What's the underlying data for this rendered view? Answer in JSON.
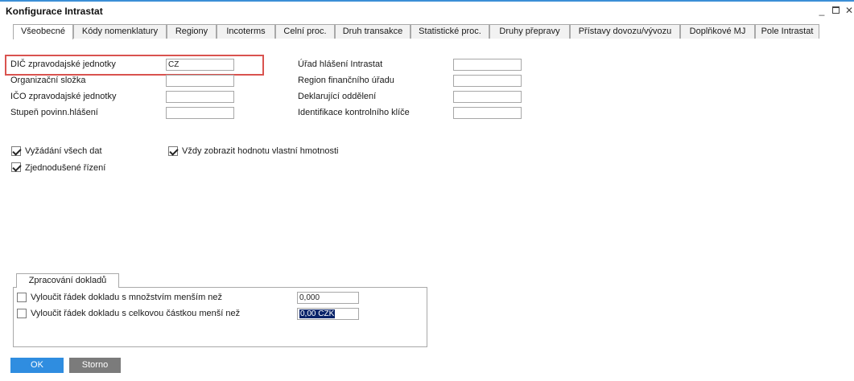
{
  "window": {
    "title": "Konfigurace Intrastat",
    "minimize_glyph": "_",
    "close_glyph": "✕"
  },
  "tabs": [
    {
      "label": "Všeobecné",
      "active": true
    },
    {
      "label": "Kódy nomenklatury",
      "active": false
    },
    {
      "label": "Regiony",
      "active": false
    },
    {
      "label": "Incoterms",
      "active": false
    },
    {
      "label": "Celní proc.",
      "active": false
    },
    {
      "label": "Druh transakce",
      "active": false
    },
    {
      "label": "Statistické proc.",
      "active": false
    },
    {
      "label": "Druhy přepravy",
      "active": false
    },
    {
      "label": "Přístavy dovozu/vývozu",
      "active": false
    },
    {
      "label": "Doplňkové MJ",
      "active": false
    },
    {
      "label": "Pole Intrastat",
      "active": false
    }
  ],
  "left_fields": [
    {
      "label": "DIČ zpravodajské jednotky",
      "value": "CZ"
    },
    {
      "label": "Organizační složka",
      "value": ""
    },
    {
      "label": "IČO zpravodajské jednotky",
      "value": ""
    },
    {
      "label": "Stupeň povinn.hlášení",
      "value": ""
    }
  ],
  "right_fields": [
    {
      "label": "Úřad hlášení Intrastat",
      "value": ""
    },
    {
      "label": "Region finančního úřadu",
      "value": ""
    },
    {
      "label": "Deklarující oddělení",
      "value": ""
    },
    {
      "label": "Identifikace kontrolního klíče",
      "value": ""
    }
  ],
  "checkboxes": [
    {
      "label": "Vyžádání všech dat",
      "checked": true
    },
    {
      "label": "Vždy zobrazit hodnotu vlastní hmotnosti",
      "checked": true
    },
    {
      "label": "Zjednodušené řízení",
      "checked": true
    }
  ],
  "document_processing": {
    "tab_label": "Zpracování dokladů",
    "rows": [
      {
        "label": "Vyloučit řádek dokladu s množstvím menším než",
        "checked": false,
        "value": "0,000"
      },
      {
        "label": "Vyloučit řádek dokladu s celkovou částkou menší než",
        "checked": false,
        "value": "0,00 CZK"
      }
    ]
  },
  "buttons": {
    "ok": "OK",
    "cancel": "Storno"
  },
  "colors": {
    "accent": "#2f8de0",
    "cancel_button": "#7b7b7b",
    "highlight_frame": "#d9534f"
  }
}
